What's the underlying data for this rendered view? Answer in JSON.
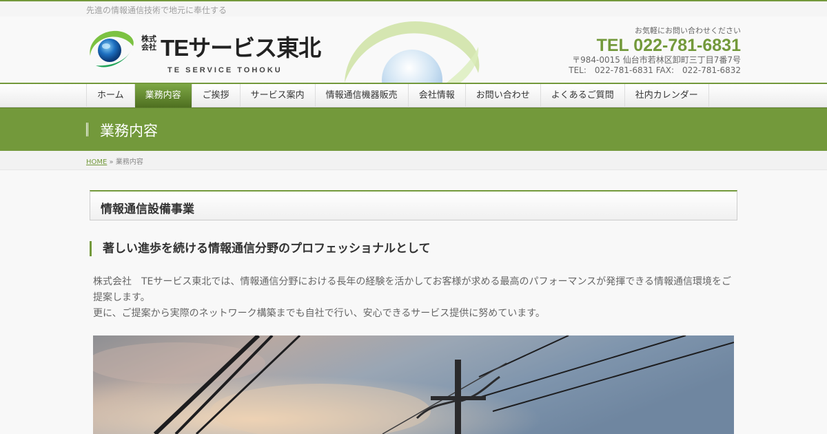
{
  "site": {
    "tagline": "先進の情報通信技術で地元に奉仕する",
    "logo": {
      "kaisha": "株式会社",
      "name": "TEサービス東北",
      "sub": "TE SERVICE TOHOKU",
      "mark_icon": "globe-swoosh-logo-icon"
    }
  },
  "contact": {
    "message": "お気軽にお問い合わせください",
    "tel": "TEL 022-781-6831",
    "address": "〒984-0015 仙台市若林区卸町三丁目7番7号",
    "tel_fax": "TEL:　022-781-6831 FAX:　022-781-6832"
  },
  "nav": {
    "items": [
      {
        "label": "ホーム"
      },
      {
        "label": "業務内容"
      },
      {
        "label": "ご挨拶"
      },
      {
        "label": "サービス案内"
      },
      {
        "label": "情報通信機器販売"
      },
      {
        "label": "会社情報"
      },
      {
        "label": "お問い合わせ"
      },
      {
        "label": "よくあるご質問"
      },
      {
        "label": "社内カレンダー"
      }
    ],
    "active_index": 1
  },
  "page": {
    "title": "業務内容",
    "breadcrumb": {
      "home": "HOME",
      "separator": "»",
      "current": "業務内容"
    }
  },
  "content": {
    "h2": "情報通信設備事業",
    "h3": "著しい進歩を続ける情報通信分野のプロフェッショナルとして",
    "paragraph1": "株式会社　TEサービス東北では、情報通信分野における長年の経験を活かしてお客様が求める最高のパフォーマンスが発揮できる情報通信環境をご提案します。",
    "paragraph2": "更に、ご提案から実際のネットワーク構築までも自社で行い、安心できるサービス提供に努めています。",
    "photo_subject": "utility-pole-power-lines-photo"
  },
  "colors": {
    "accent": "#73993b",
    "accent_dark": "#4e6f20",
    "text": "#555555"
  }
}
